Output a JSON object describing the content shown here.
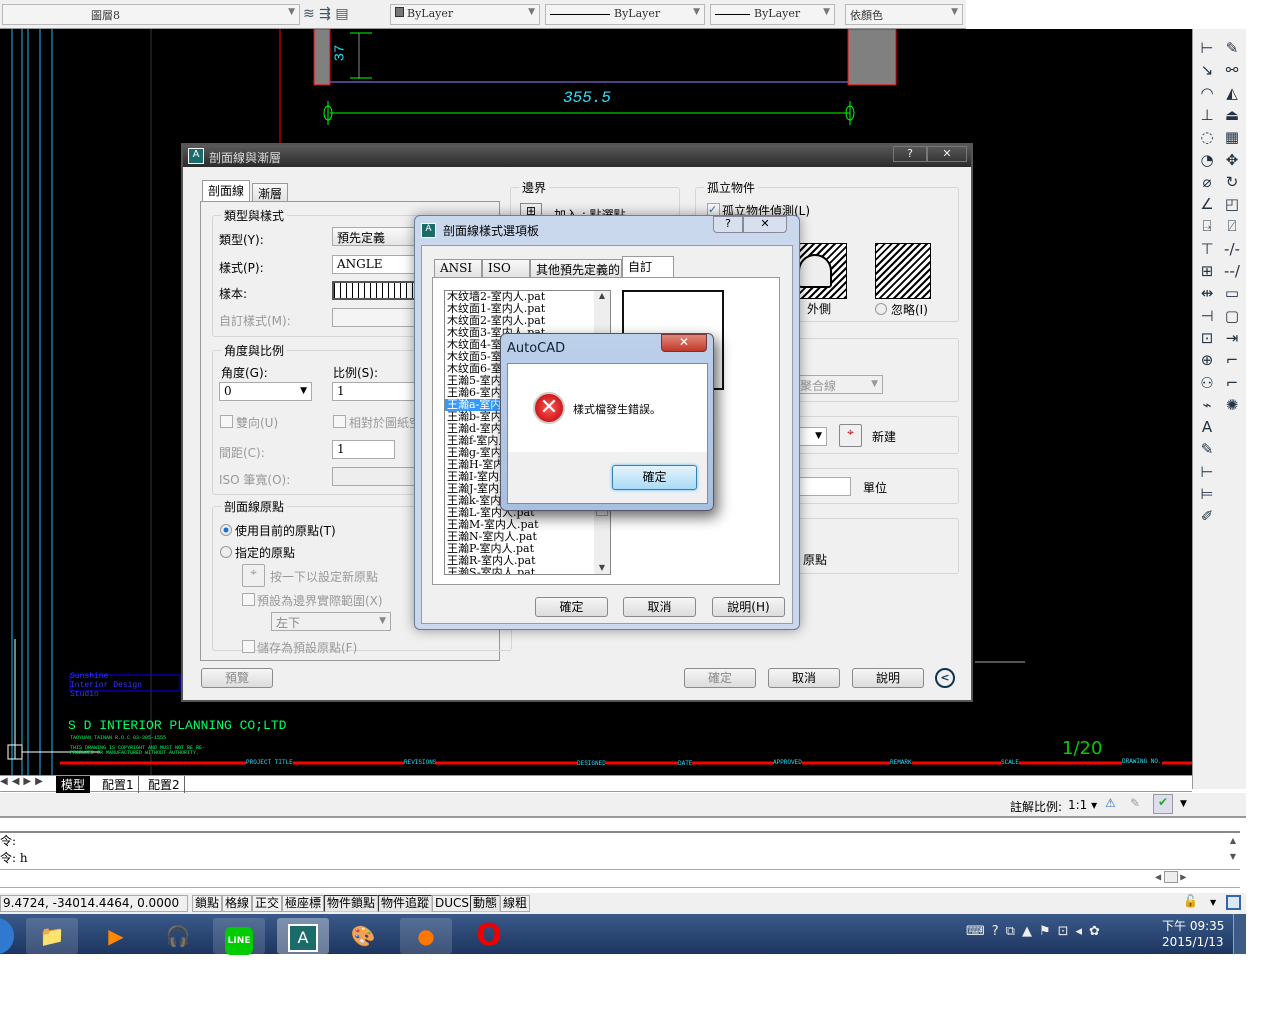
{
  "toolbar": {
    "layer": "圖層8",
    "color": "ByLayer",
    "linetype": "ByLayer",
    "lineweight": "ByLayer",
    "plotstyle": "依顏色"
  },
  "drawing": {
    "dim1": "355.5",
    "dim2": "37",
    "company_logo": "Sunshine Interior Design Studio",
    "company": "S D   INTERIOR  PLANNING  CO;LTD",
    "address": "TAOYUAN TAINAN R.O.C 03-305-1555",
    "notice1": "THIS DRAWING IS COPYRIGHT AND MUST NOT BE RE-",
    "notice2": "PRODUCED OR MANUFACTURED WITHOUT AUTHORITY.",
    "title_labels": [
      "PROJECT TITLE",
      "REVISIONS",
      "DESIGNED",
      "DATE",
      "APPROVED",
      "REMARK",
      "SCALE",
      "DRAWING NO."
    ],
    "scale": "1/20"
  },
  "layout_tabs": [
    "模型",
    "配置1",
    "配置2"
  ],
  "annotation": {
    "label": "註解比例:",
    "value": "1:1"
  },
  "command": {
    "lines": [
      "令:",
      "令: h"
    ]
  },
  "status": {
    "coords": "9.4724, -34014.4464, 0.0000",
    "buttons": [
      {
        "label": "鎖點",
        "on": false
      },
      {
        "label": "格線",
        "on": false
      },
      {
        "label": "正交",
        "on": false
      },
      {
        "label": "極座標",
        "on": false
      },
      {
        "label": "物件鎖點",
        "on": true
      },
      {
        "label": "物件追蹤",
        "on": true
      },
      {
        "label": "DUCS",
        "on": false
      },
      {
        "label": "動態",
        "on": true
      },
      {
        "label": "線粗",
        "on": false
      }
    ]
  },
  "clock": {
    "time": "下午 09:35",
    "date": "2015/1/13"
  },
  "hatch_dialog": {
    "title": "剖面線與漸層",
    "help": "?",
    "close": "✕",
    "tabs": [
      "剖面線",
      "漸層"
    ],
    "type_group": "類型與樣式",
    "type_label": "類型(Y):",
    "type_value": "預先定義",
    "pattern_label": "樣式(P):",
    "pattern_value": "ANGLE",
    "swatch_label": "樣本:",
    "custom_label": "自訂樣式(M):",
    "angle_group": "角度與比例",
    "angle_label": "角度(G):",
    "angle_value": "0",
    "scale_label": "比例(S):",
    "scale_value": "1",
    "double_label": "雙向(U)",
    "relative_label": "相對於圖紙空",
    "spacing_label": "間距(C):",
    "spacing_value": "1",
    "iso_label": "ISO 筆寬(O):",
    "origin_group": "剖面線原點",
    "use_current": "使用目前的原點(T)",
    "specified": "指定的原點",
    "click_set": "按一下以設定新原點",
    "default_extents": "預設為邊界實際範圍(X)",
    "extent_value": "左下",
    "store_default": "儲存為預設原點(F)",
    "boundary_group": "邊界",
    "add_pick": "加入 : 點選點",
    "islands_group": "孤立物件",
    "island_detect": "孤立物件偵測(L)",
    "outer": "外側",
    "ignore": "忽略(I)",
    "boundary_type": "聚合線",
    "new_label": "新建",
    "units_label": "單位",
    "origin_tail": "原點",
    "preview": "預覽",
    "ok": "確定",
    "cancel": "取消",
    "help_btn": "說明"
  },
  "palette": {
    "title": "剖面線樣式選項板",
    "help": "?",
    "close": "✕",
    "tabs": [
      "ANSI",
      "ISO",
      "其他預先定義的",
      "自訂"
    ],
    "items": [
      "木纹墙2-室内人.pat",
      "木纹面1-室内人.pat",
      "木纹面2-室内人.pat",
      "木纹面3-室内人.pat",
      "木纹面4-室内人.pat",
      "木纹面5-室内人.pat",
      "木纹面6-室内人.pat",
      "王瀚5-室内人.pat",
      "王瀚6-室内人.pat",
      "王瀚a-室内人.pat",
      "王瀚b-室内人.pat",
      "王瀚d-室内人.pat",
      "王瀚f-室内人.pat",
      "王瀚g-室内人.pat",
      "王瀚H-室内人.pat",
      "王瀚I-室内人.pat",
      "王瀚J-室内人.pat",
      "王瀚k-室内人.pat",
      "王瀚L-室内人.pat",
      "王瀚M-室内人.pat",
      "王瀚N-室内人.pat",
      "王瀚P-室内人.pat",
      "王瀚R-室内人.pat",
      "王瀚S-室内人.pat"
    ],
    "selected": 9,
    "ok": "確定",
    "cancel": "取消",
    "help_btn": "說明(H)"
  },
  "alert": {
    "title": "AutoCAD",
    "message": "樣式檔發生錯誤。",
    "ok": "確定",
    "close": "✕"
  }
}
